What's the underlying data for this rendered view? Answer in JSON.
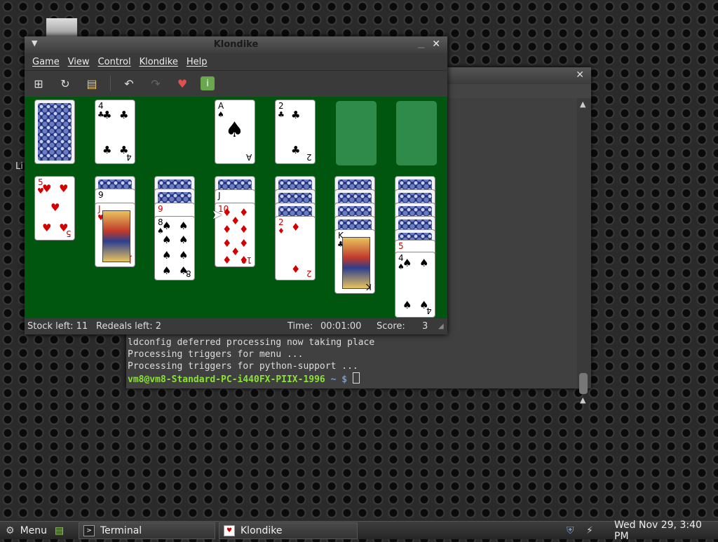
{
  "desktop": {
    "partial_label": "Li"
  },
  "terminal": {
    "lines": [
      "ldconfig deferred processing now taking place",
      "Processing triggers for menu ...",
      "Processing triggers for python-support ..."
    ],
    "prompt_user": "vm8@vm8-Standard-PC-i440FX-PIIX-1996",
    "prompt_path": "~",
    "prompt_symbol": "$"
  },
  "klondike": {
    "title": "Klondike",
    "menu": [
      "Game",
      "View",
      "Control",
      "Klondike",
      "Help"
    ],
    "toolbar_icons": [
      "new-game-icon",
      "restart-icon",
      "select-game-icon",
      "undo-icon",
      "redo-icon",
      "hint-icon",
      "info-icon"
    ],
    "foundations": [
      {
        "rank": "A",
        "suit": "♠",
        "color": "black"
      },
      {
        "rank": "2",
        "suit": "♣",
        "color": "black"
      }
    ],
    "waste": {
      "rank": "4",
      "suit": "♣",
      "color": "black"
    },
    "tableau": [
      {
        "top": {
          "rank": "5",
          "suit": "♥",
          "color": "red"
        }
      },
      {
        "top": {
          "rank": "J",
          "suit": "♥",
          "color": "red"
        },
        "under": "9"
      },
      {
        "top": {
          "rank": "8",
          "suit": "♠",
          "color": "black"
        },
        "under": "9"
      },
      {
        "top": {
          "rank": "10",
          "suit": "♦",
          "color": "red"
        },
        "under": "J"
      },
      {
        "top": {
          "rank": "2",
          "suit": "♦",
          "color": "red"
        }
      },
      {
        "top": {
          "rank": "K",
          "suit": "♣",
          "color": "black"
        }
      },
      {
        "top": {
          "rank": "4",
          "suit": "♠",
          "color": "black"
        },
        "under": "5"
      }
    ],
    "status": {
      "stock": "Stock left: 11",
      "redeals": "Redeals left: 2",
      "time_label": "Time:",
      "time": "00:01:00",
      "score_label": "Score:",
      "score": "3"
    },
    "felt_color": "#00560e"
  },
  "taskbar": {
    "menu_label": "Menu",
    "tasks": [
      "Terminal",
      "Klondike"
    ],
    "clock": "Wed Nov 29,  3:40 PM"
  }
}
